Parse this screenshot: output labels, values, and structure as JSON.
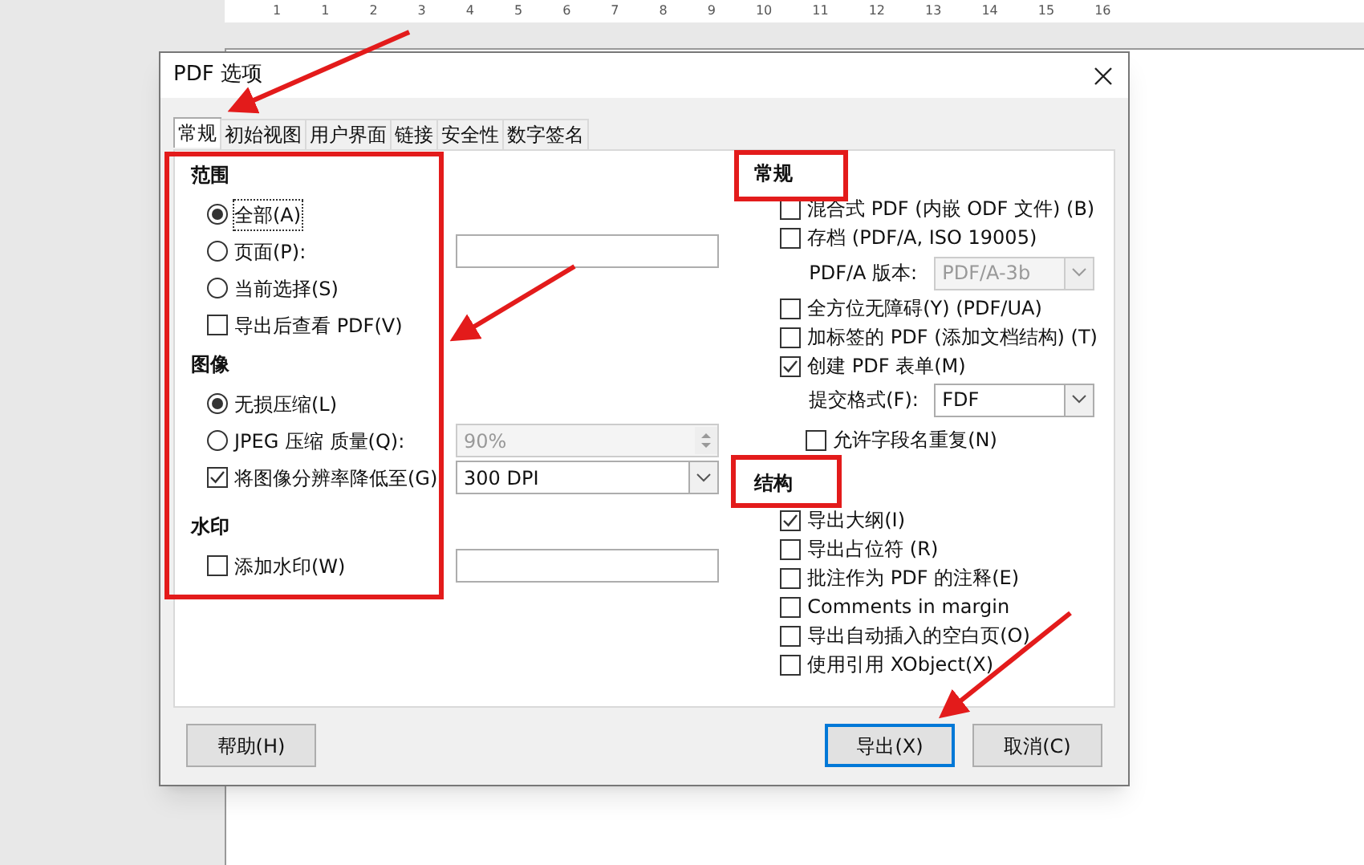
{
  "ruler": {
    "labels": [
      "1",
      "1",
      "2",
      "3",
      "4",
      "5",
      "6",
      "7",
      "8",
      "9",
      "10",
      "11",
      "12",
      "13",
      "14",
      "15",
      "16"
    ]
  },
  "dialog": {
    "title": "PDF 选项",
    "tabs": [
      {
        "label": "常规",
        "selected": true
      },
      {
        "label": "初始视图",
        "selected": false
      },
      {
        "label": "用户界面",
        "selected": false
      },
      {
        "label": "链接",
        "selected": false
      },
      {
        "label": "安全性",
        "selected": false
      },
      {
        "label": "数字签名",
        "selected": false
      }
    ],
    "left": [
      {
        "kind": "heading",
        "label": "范围"
      },
      {
        "kind": "radio",
        "label": "全部(A)",
        "selected": true,
        "focused": true
      },
      {
        "kind": "radio",
        "label": "页面(P):",
        "selected": false,
        "field": {
          "kind": "text",
          "disabled": false
        }
      },
      {
        "kind": "radio",
        "label": "当前选择(S)",
        "selected": false
      },
      {
        "kind": "checkbox",
        "label": "导出后查看 PDF(V)",
        "checked": false
      },
      {
        "kind": "heading",
        "label": "图像"
      },
      {
        "kind": "radio",
        "label": "无损压缩(L)",
        "selected": true
      },
      {
        "kind": "radio",
        "label": "JPEG 压缩  质量(Q):",
        "selected": false,
        "field": {
          "kind": "spin",
          "value": "90%",
          "disabled": true
        }
      },
      {
        "kind": "checkbox",
        "label": "将图像分辨率降低至(G)",
        "checked": true,
        "field": {
          "kind": "select",
          "value": "300 DPI",
          "disabled": false
        }
      },
      {
        "kind": "spacer"
      },
      {
        "kind": "heading",
        "label": "水印"
      },
      {
        "kind": "checkbox",
        "label": "添加水印(W)",
        "checked": false,
        "field": {
          "kind": "text",
          "disabled": false
        }
      }
    ],
    "right": [
      {
        "kind": "heading",
        "label": "常规"
      },
      {
        "kind": "checkbox",
        "label": "混合式 PDF (内嵌 ODF 文件) (B)",
        "checked": false
      },
      {
        "kind": "checkbox",
        "label": "存档 (PDF/A, ISO 19005)",
        "checked": false
      },
      {
        "kind": "select",
        "label": "PDF/A 版本:",
        "value": "PDF/A-3b",
        "disabled": true
      },
      {
        "kind": "checkbox",
        "label": "全方位无障碍(Y) (PDF/UA)",
        "checked": false
      },
      {
        "kind": "checkbox",
        "label": "加标签的 PDF (添加文档结构) (T)",
        "checked": false
      },
      {
        "kind": "checkbox",
        "label": "创建 PDF 表单(M)",
        "checked": true
      },
      {
        "kind": "select",
        "label": "提交格式(F):",
        "value": "FDF",
        "disabled": false
      },
      {
        "kind": "subcheckbox",
        "label": "允许字段名重复(N)",
        "checked": false
      },
      {
        "kind": "heading",
        "label": "结构"
      },
      {
        "kind": "checkbox",
        "label": "导出大纲(I)",
        "checked": true
      },
      {
        "kind": "checkbox",
        "label": "导出占位符 (R)",
        "checked": false
      },
      {
        "kind": "checkbox",
        "label": "批注作为 PDF 的注释(E)",
        "checked": false
      },
      {
        "kind": "checkbox",
        "label": "Comments in margin",
        "checked": false
      },
      {
        "kind": "checkbox",
        "label": "导出自动插入的空白页(O)",
        "checked": false
      },
      {
        "kind": "checkbox",
        "label": "使用引用 XObject(X)",
        "checked": false
      }
    ],
    "buttons": [
      {
        "label": "帮助(H)",
        "default": false
      },
      {
        "label": "导出(X)",
        "default": true
      },
      {
        "label": "取消(C)",
        "default": false
      }
    ]
  }
}
